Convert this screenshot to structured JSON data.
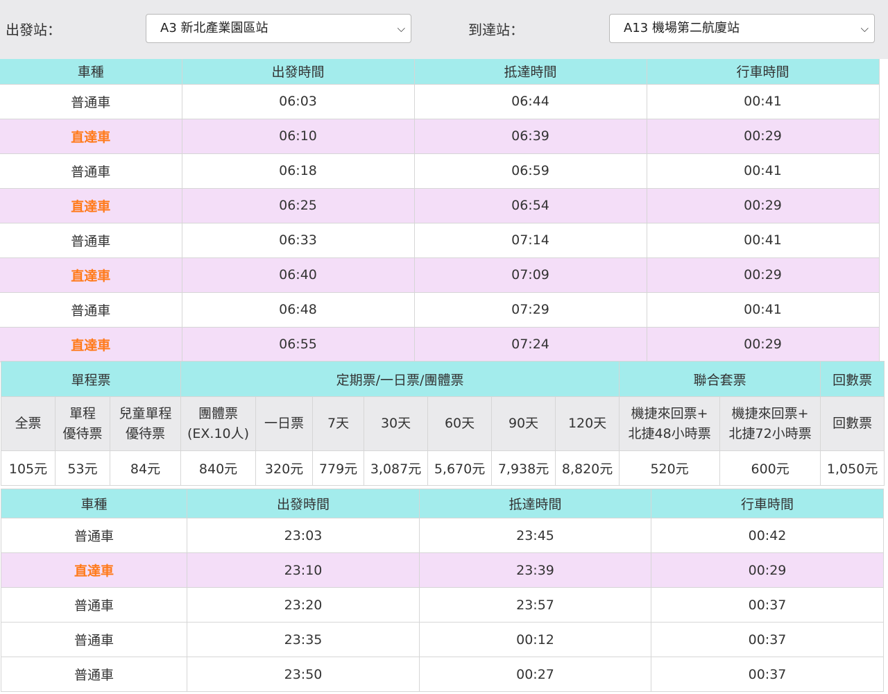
{
  "selector": {
    "origin_label": "出發站：",
    "origin_value": "A3 新北產業園區站",
    "dest_label": "到達站：",
    "dest_value": "A13 機場第二航廈站"
  },
  "schedule_headers": [
    "車種",
    "出發時間",
    "抵達時間",
    "行車時間"
  ],
  "schedule1": [
    {
      "type": "普通車",
      "depart": "06:03",
      "arrive": "06:44",
      "duration": "00:41",
      "express": false
    },
    {
      "type": "直達車",
      "depart": "06:10",
      "arrive": "06:39",
      "duration": "00:29",
      "express": true
    },
    {
      "type": "普通車",
      "depart": "06:18",
      "arrive": "06:59",
      "duration": "00:41",
      "express": false
    },
    {
      "type": "直達車",
      "depart": "06:25",
      "arrive": "06:54",
      "duration": "00:29",
      "express": true
    },
    {
      "type": "普通車",
      "depart": "06:33",
      "arrive": "07:14",
      "duration": "00:41",
      "express": false
    },
    {
      "type": "直達車",
      "depart": "06:40",
      "arrive": "07:09",
      "duration": "00:29",
      "express": true
    },
    {
      "type": "普通車",
      "depart": "06:48",
      "arrive": "07:29",
      "duration": "00:41",
      "express": false
    },
    {
      "type": "直達車",
      "depart": "06:55",
      "arrive": "07:24",
      "duration": "00:29",
      "express": true
    }
  ],
  "fare": {
    "groups": [
      "單程票",
      "定期票/一日票/團體票",
      "聯合套票",
      "回數票"
    ],
    "subheaders": [
      [
        "全票"
      ],
      [
        "單程",
        "優待票"
      ],
      [
        "兒童單程",
        "優待票"
      ],
      [
        "團體票",
        "(EX.10人)"
      ],
      [
        "一日票"
      ],
      [
        "7天"
      ],
      [
        "30天"
      ],
      [
        "60天"
      ],
      [
        "90天"
      ],
      [
        "120天"
      ],
      [
        "機捷來回票+",
        "北捷48小時票"
      ],
      [
        "機捷來回票+",
        "北捷72小時票"
      ],
      [
        "回數票"
      ]
    ],
    "prices": [
      "105元",
      "53元",
      "84元",
      "840元",
      "320元",
      "779元",
      "3,087元",
      "5,670元",
      "7,938元",
      "8,820元",
      "520元",
      "600元",
      "1,050元"
    ]
  },
  "schedule2": [
    {
      "type": "普通車",
      "depart": "23:03",
      "arrive": "23:45",
      "duration": "00:42",
      "express": false
    },
    {
      "type": "直達車",
      "depart": "23:10",
      "arrive": "23:39",
      "duration": "00:29",
      "express": true
    },
    {
      "type": "普通車",
      "depart": "23:20",
      "arrive": "23:57",
      "duration": "00:37",
      "express": false
    },
    {
      "type": "普通車",
      "depart": "23:35",
      "arrive": "00:12",
      "duration": "00:37",
      "express": false
    },
    {
      "type": "普通車",
      "depart": "23:50",
      "arrive": "00:27",
      "duration": "00:37",
      "express": false
    }
  ],
  "colors": {
    "header_bg": "#a3ecec",
    "alt_row_bg": "#f4def8",
    "express_text": "#ff7a1a",
    "topbar_bg": "#eaeaec"
  }
}
